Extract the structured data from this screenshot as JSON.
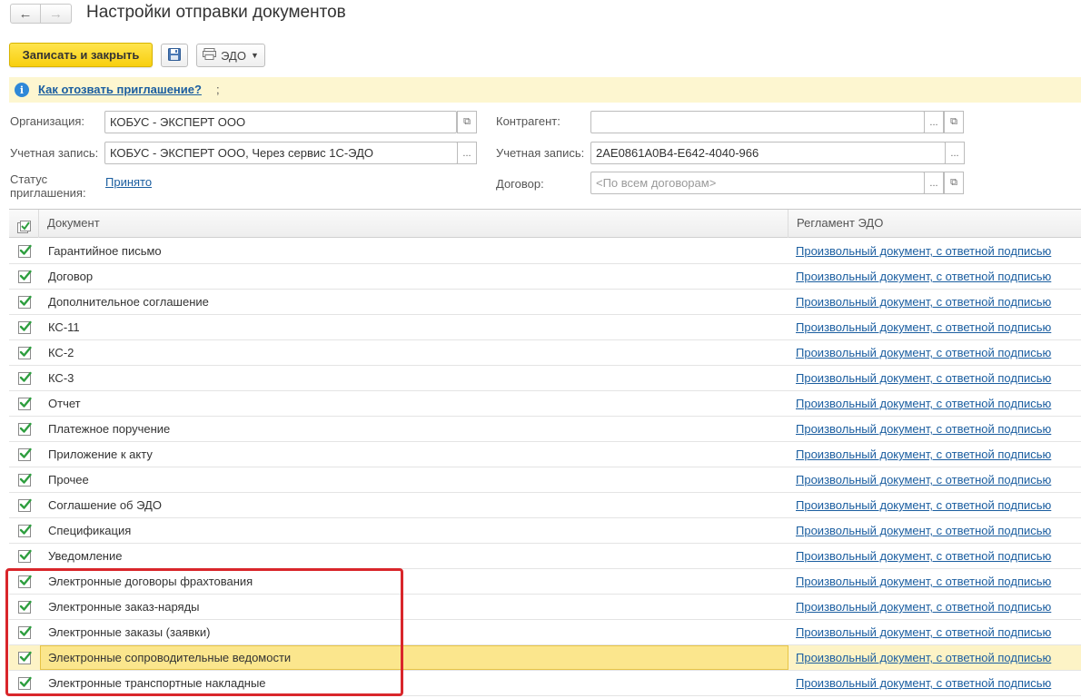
{
  "window": {
    "title": "Настройки отправки документов"
  },
  "toolbar": {
    "save_close_label": "Записать и закрыть",
    "edo_label": "ЭДО"
  },
  "info": {
    "link_text": "Как отозвать приглашение?",
    "link_suffix": ";"
  },
  "form": {
    "organization": {
      "label": "Организация:",
      "value": "КОБУС - ЭКСПЕРТ ООО"
    },
    "account_left": {
      "label": "Учетная запись:",
      "value": "КОБУС - ЭКСПЕРТ ООО, Через сервис 1С-ЭДО"
    },
    "status": {
      "label_line1": "Статус",
      "label_line2": "приглашения:",
      "value": "Принято"
    },
    "counterparty": {
      "label": "Контрагент:",
      "value": ""
    },
    "account_right": {
      "label": "Учетная запись:",
      "value": "2AE0861A0B4-E642-4040-966"
    },
    "contract": {
      "label": "Договор:",
      "placeholder": "<По всем договорам>"
    }
  },
  "table": {
    "columns": {
      "document": "Документ",
      "regulation": "Регламент ЭДО"
    },
    "rows": [
      {
        "checked": true,
        "document": "Гарантийное письмо",
        "regulation": "Произвольный документ, с ответной подписью"
      },
      {
        "checked": true,
        "document": "Договор",
        "regulation": "Произвольный документ, с ответной подписью"
      },
      {
        "checked": true,
        "document": "Дополнительное соглашение",
        "regulation": "Произвольный документ, с ответной подписью"
      },
      {
        "checked": true,
        "document": "КС-11",
        "regulation": "Произвольный документ, с ответной подписью"
      },
      {
        "checked": true,
        "document": "КС-2",
        "regulation": "Произвольный документ, с ответной подписью"
      },
      {
        "checked": true,
        "document": "КС-3",
        "regulation": "Произвольный документ, с ответной подписью"
      },
      {
        "checked": true,
        "document": "Отчет",
        "regulation": "Произвольный документ, с ответной подписью"
      },
      {
        "checked": true,
        "document": "Платежное поручение",
        "regulation": "Произвольный документ, с ответной подписью"
      },
      {
        "checked": true,
        "document": "Приложение к акту",
        "regulation": "Произвольный документ, с ответной подписью"
      },
      {
        "checked": true,
        "document": "Прочее",
        "regulation": "Произвольный документ, с ответной подписью"
      },
      {
        "checked": true,
        "document": "Соглашение об ЭДО",
        "regulation": "Произвольный документ, с ответной подписью"
      },
      {
        "checked": true,
        "document": "Спецификация",
        "regulation": "Произвольный документ, с ответной подписью"
      },
      {
        "checked": true,
        "document": "Уведомление",
        "regulation": "Произвольный документ, с ответной подписью"
      },
      {
        "checked": true,
        "document": "Электронные договоры фрахтования",
        "regulation": "Произвольный документ, с ответной подписью"
      },
      {
        "checked": true,
        "document": "Электронные заказ-наряды",
        "regulation": "Произвольный документ, с ответной подписью"
      },
      {
        "checked": true,
        "document": "Электронные заказы (заявки)",
        "regulation": "Произвольный документ, с ответной подписью"
      },
      {
        "checked": true,
        "document": "Электронные сопроводительные ведомости",
        "regulation": "Произвольный документ, с ответной подписью",
        "selected": true
      },
      {
        "checked": true,
        "document": "Электронные транспортные накладные",
        "regulation": "Произвольный документ, с ответной подписью"
      }
    ]
  },
  "colors": {
    "accent_yellow": "#f8cf0f",
    "link_blue": "#1b5ea0",
    "check_green": "#2e9e3f",
    "selection_yellow": "#fbe68d",
    "highlight_red": "#d9262b",
    "info_bg": "#fdf6d0"
  },
  "icons": {
    "back": "arrow-left-icon",
    "forward": "arrow-right-icon",
    "save": "floppy-disk-icon",
    "edo": "edo-document-icon",
    "info": "info-icon",
    "open": "open-form-icon",
    "select": "ellipsis-icon",
    "check": "checkmark-icon"
  }
}
